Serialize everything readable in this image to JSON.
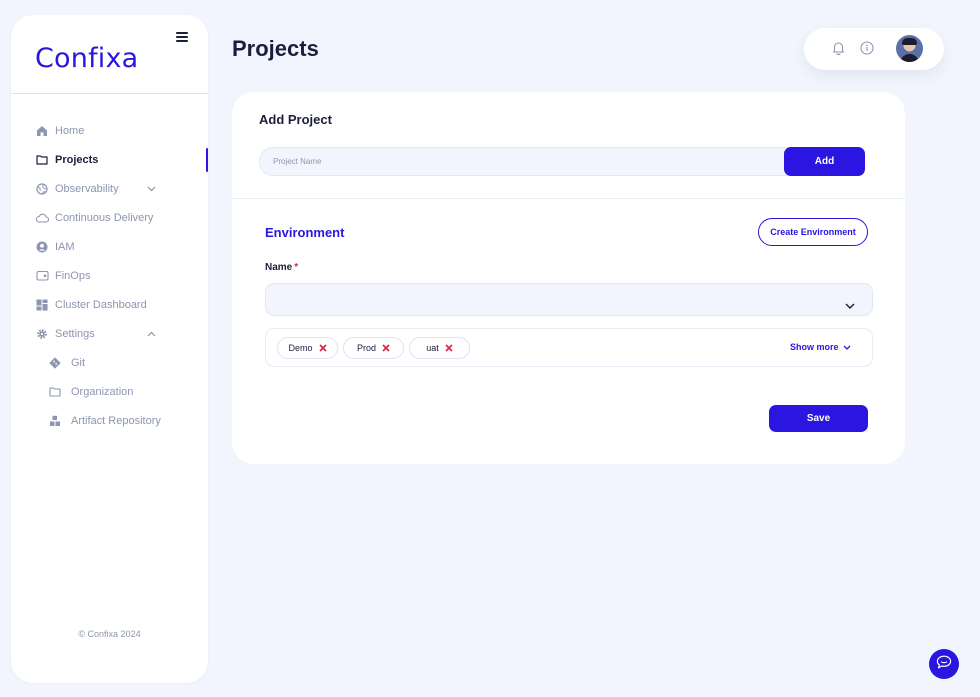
{
  "app": {
    "logo": "Confixa",
    "footer": "© Confixa 2024"
  },
  "sidebar": {
    "items": [
      {
        "label": "Home",
        "icon": "home-icon"
      },
      {
        "label": "Projects",
        "icon": "folder-icon",
        "active": true
      },
      {
        "label": "Observability",
        "icon": "globe-icon",
        "expandable": true
      },
      {
        "label": "Continuous Delivery",
        "icon": "cloud-icon"
      },
      {
        "label": "IAM",
        "icon": "user-circle-icon"
      },
      {
        "label": "FinOps",
        "icon": "wallet-icon"
      },
      {
        "label": "Cluster Dashboard",
        "icon": "dashboard-icon"
      },
      {
        "label": "Settings",
        "icon": "gear-icon",
        "expanded": true
      }
    ],
    "settings_sub": [
      {
        "label": "Git",
        "icon": "git-icon"
      },
      {
        "label": "Organization",
        "icon": "folder-icon"
      },
      {
        "label": "Artifact Repository",
        "icon": "boxes-icon"
      }
    ]
  },
  "header": {
    "title": "Projects",
    "icons": [
      "bell-icon",
      "info-icon",
      "avatar"
    ]
  },
  "add_project": {
    "title": "Add Project",
    "input_placeholder": "Project Name",
    "input_value": "",
    "add_label": "Add"
  },
  "environment": {
    "title": "Environment",
    "create_label": "Create Environment",
    "name_label": "Name",
    "required_mark": "*",
    "select_value": "",
    "tags": [
      "Demo",
      "Prod",
      "uat"
    ],
    "show_more_label": "Show more",
    "save_label": "Save"
  },
  "colors": {
    "accent": "#2a16e0",
    "background": "#f2f5fd",
    "muted_text": "#8d95b0",
    "required": "#e11d48"
  }
}
